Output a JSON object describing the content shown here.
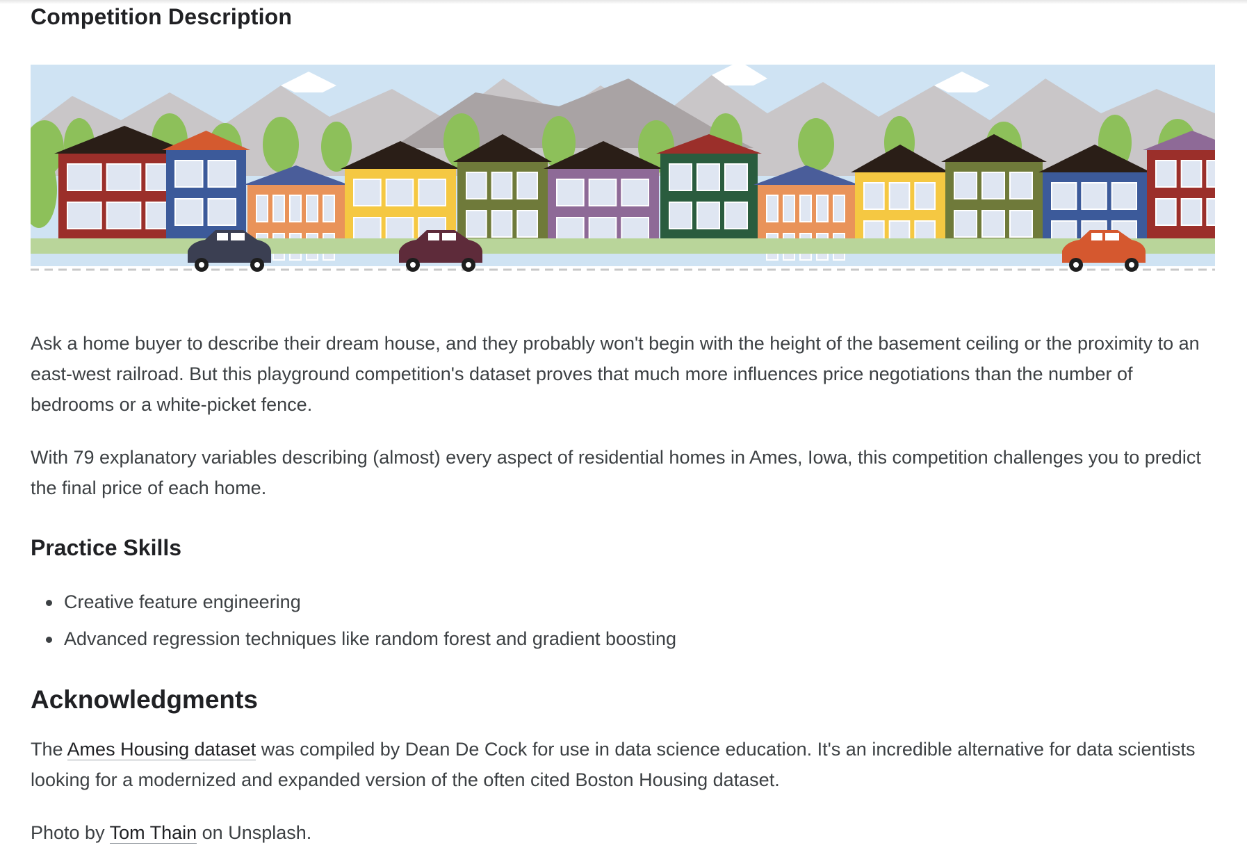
{
  "section_title": "Competition Description",
  "banner": {
    "icon": "neighborhood-houses-illustration"
  },
  "intro": {
    "p1": "Ask a home buyer to describe their dream house, and they probably won't begin with the height of the basement ceiling or the proximity to an east-west railroad. But this playground competition's dataset proves that much more influences price negotiations than the number of bedrooms or a white-picket fence.",
    "p2": "With 79 explanatory variables describing (almost) every aspect of residential homes in Ames, Iowa, this competition challenges you to predict the final price of each home."
  },
  "practice": {
    "heading": "Practice Skills",
    "items": [
      "Creative feature engineering",
      "Advanced regression techniques like random forest and gradient boosting"
    ]
  },
  "acknowledgments": {
    "heading": "Acknowledgments",
    "pre_link": "The ",
    "link_text": "Ames Housing dataset",
    "post_link": " was compiled by Dean De Cock for use in data science education. It's an incredible alternative for data scientists looking for a modernized and expanded version of the often cited Boston Housing dataset."
  },
  "credit": {
    "pre": "Photo by ",
    "link_text": "Tom Thain",
    "post": " on Unsplash."
  },
  "colors": {
    "sky": "#cfe3f3",
    "mountain_far": "#c9c6c8",
    "mountain_near": "#a9a3a4",
    "grass": "#b9d59a",
    "tree": "#8dc05a",
    "window": "#dfe6f2"
  }
}
